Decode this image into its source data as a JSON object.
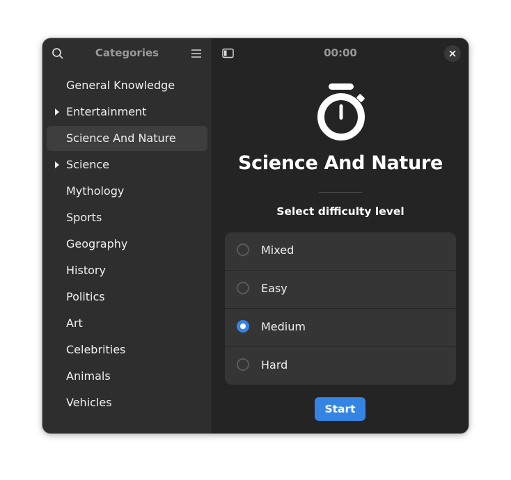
{
  "sidebar": {
    "title": "Categories",
    "search_icon": "search-icon",
    "menu_icon": "hamburger-menu-icon",
    "items": [
      {
        "label": "General Knowledge",
        "expandable": false,
        "selected": false
      },
      {
        "label": "Entertainment",
        "expandable": true,
        "selected": false
      },
      {
        "label": "Science And Nature",
        "expandable": false,
        "selected": true
      },
      {
        "label": "Science",
        "expandable": true,
        "selected": false
      },
      {
        "label": "Mythology",
        "expandable": false,
        "selected": false
      },
      {
        "label": "Sports",
        "expandable": false,
        "selected": false
      },
      {
        "label": "Geography",
        "expandable": false,
        "selected": false
      },
      {
        "label": "History",
        "expandable": false,
        "selected": false
      },
      {
        "label": "Politics",
        "expandable": false,
        "selected": false
      },
      {
        "label": "Art",
        "expandable": false,
        "selected": false
      },
      {
        "label": "Celebrities",
        "expandable": false,
        "selected": false
      },
      {
        "label": "Animals",
        "expandable": false,
        "selected": false
      },
      {
        "label": "Vehicles",
        "expandable": false,
        "selected": false
      }
    ]
  },
  "header": {
    "timer": "00:00",
    "sidebar_toggle_icon": "sidebar-toggle-icon",
    "close_icon": "close-icon"
  },
  "main": {
    "icon": "stopwatch-icon",
    "title": "Science And Nature",
    "difficulty_label": "Select difficulty level",
    "options": [
      {
        "label": "Mixed",
        "checked": false
      },
      {
        "label": "Easy",
        "checked": false
      },
      {
        "label": "Medium",
        "checked": true
      },
      {
        "label": "Hard",
        "checked": false
      }
    ],
    "start_label": "Start"
  },
  "colors": {
    "accent": "#3584e4",
    "sidebar_bg": "#2e2e2e",
    "content_bg": "#242424",
    "card_bg": "#353535"
  }
}
